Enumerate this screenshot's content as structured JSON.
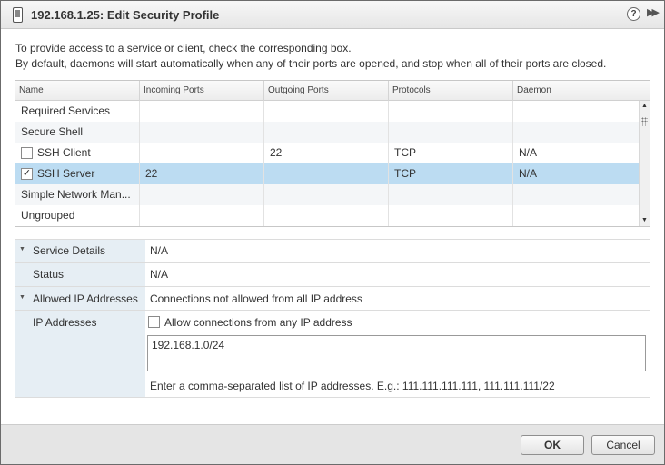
{
  "window": {
    "title": "192.168.1.25: Edit Security Profile",
    "help_glyph": "?",
    "expand_glyph": "▶▶"
  },
  "intro": {
    "line1": "To provide access to a service or client, check the corresponding box.",
    "line2": "By default, daemons will start automatically when any of their ports are opened, and stop when all of their ports are closed."
  },
  "table": {
    "columns": [
      "Name",
      "Incoming Ports",
      "Outgoing Ports",
      "Protocols",
      "Daemon"
    ],
    "rows": [
      {
        "name": "Required Services",
        "incoming": "",
        "outgoing": "",
        "protocols": "",
        "daemon": "",
        "checkbox": null
      },
      {
        "name": "Secure Shell",
        "incoming": "",
        "outgoing": "",
        "protocols": "",
        "daemon": "",
        "checkbox": null
      },
      {
        "name": "SSH Client",
        "incoming": "",
        "outgoing": "22",
        "protocols": "TCP",
        "daemon": "N/A",
        "checkbox": false
      },
      {
        "name": "SSH Server",
        "incoming": "22",
        "outgoing": "",
        "protocols": "TCP",
        "daemon": "N/A",
        "checkbox": true,
        "selected": true
      },
      {
        "name": "Simple Network Man...",
        "incoming": "",
        "outgoing": "",
        "protocols": "",
        "daemon": "",
        "checkbox": null
      },
      {
        "name": "Ungrouped",
        "incoming": "",
        "outgoing": "",
        "protocols": "",
        "daemon": "",
        "checkbox": null
      }
    ]
  },
  "details": {
    "service_details_label": "Service Details",
    "service_details_value": "N/A",
    "status_label": "Status",
    "status_value": "N/A",
    "allowed_ip_label": "Allowed IP Addresses",
    "allowed_ip_value": "Connections not allowed from all IP address",
    "ip_addresses_label": "IP Addresses",
    "allow_any_label": "Allow connections from any IP address",
    "allow_any_checked": false,
    "ip_list_value": "192.168.1.0/24",
    "hint": "Enter a comma-separated list of IP addresses. E.g.: 111.111.111.111, 111.111.111/22"
  },
  "buttons": {
    "ok": "OK",
    "cancel": "Cancel"
  },
  "colors": {
    "selected_row": "#bcdcf2",
    "label_column": "#e6eef4"
  }
}
